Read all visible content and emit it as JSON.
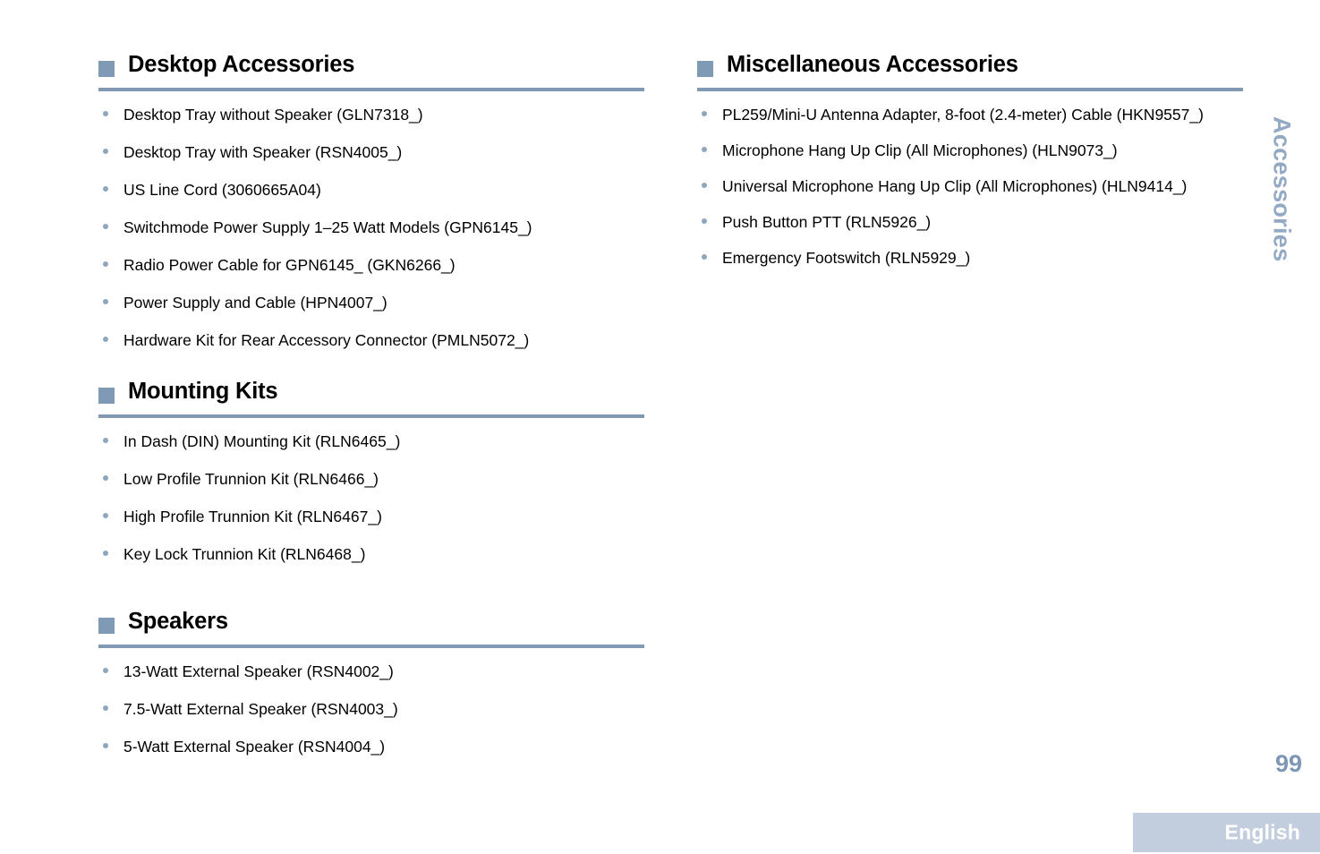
{
  "document": {
    "side_tab_label": "Accessories",
    "page_number": "99",
    "language_label": "English"
  },
  "colors": {
    "accent_steel_blue": "#7f9ab5",
    "rule_blue": "#8199b2",
    "bullet_blue": "#8fa6bf",
    "side_tab_blue": "#93a9c4",
    "page_number_blue": "#7d97b4",
    "language_bar_bg": "#c2cedd",
    "language_text": "#ffffff",
    "body_text": "#000000",
    "page_background": "#ffffff"
  },
  "left_column": {
    "sections": [
      {
        "title": "Desktop Accessories",
        "items": [
          "Desktop Tray without Speaker (GLN7318_)",
          "Desktop Tray with Speaker (RSN4005_)",
          "US Line Cord (3060665A04)",
          "Switchmode Power Supply 1–25 Watt Models (GPN6145_)",
          "Radio Power Cable for GPN6145_ (GKN6266_)",
          "Power Supply and Cable (HPN4007_)",
          "Hardware Kit for Rear Accessory Connector (PMLN5072_)"
        ]
      },
      {
        "title": "Mounting Kits",
        "items": [
          "In Dash (DIN) Mounting Kit (RLN6465_)",
          "Low Profile Trunnion Kit (RLN6466_)",
          "High Profile Trunnion Kit (RLN6467_)",
          "Key Lock Trunnion Kit (RLN6468_)"
        ]
      },
      {
        "title": "Speakers",
        "items": [
          "13-Watt External Speaker (RSN4002_)",
          "7.5-Watt External Speaker (RSN4003_)",
          "5-Watt External Speaker (RSN4004_)"
        ]
      }
    ]
  },
  "right_column": {
    "sections": [
      {
        "title": "Miscellaneous Accessories",
        "items": [
          "PL259/Mini-U Antenna Adapter, 8-foot (2.4-meter) Cable (HKN9557_)",
          "Microphone Hang Up Clip (All Microphones) (HLN9073_)",
          "Universal Microphone Hang Up Clip (All Microphones) (HLN9414_)",
          "Push Button PTT (RLN5926_)",
          "Emergency Footswitch (RLN5929_)"
        ]
      }
    ]
  }
}
